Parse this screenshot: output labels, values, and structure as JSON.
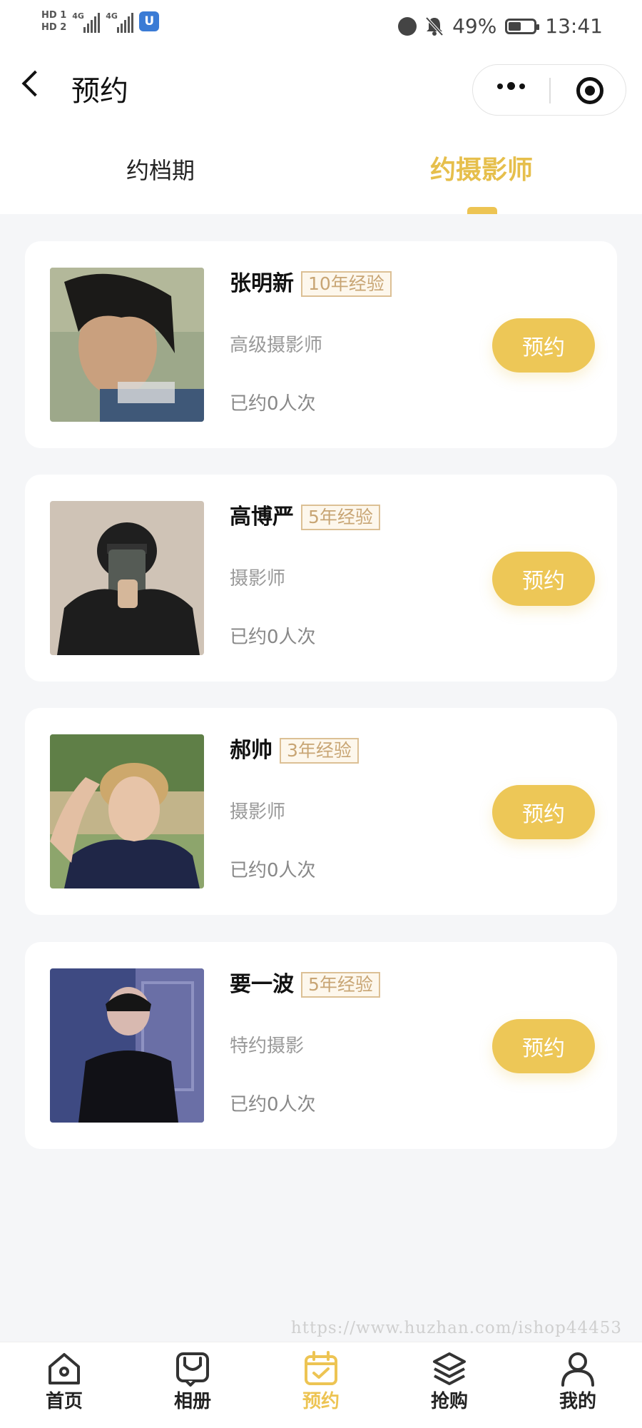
{
  "status_bar": {
    "hd1": "HD 1",
    "hd2": "HD 2",
    "net1": "4G",
    "net2": "4G",
    "app_badge": "U",
    "battery_text": "49%",
    "battery_level": 0.49,
    "time": "13:41"
  },
  "header": {
    "title": "预约"
  },
  "tabs": [
    {
      "label": "约档期",
      "active": false
    },
    {
      "label": "约摄影师",
      "active": true
    }
  ],
  "photographers": [
    {
      "name": "张明新",
      "experience": "10年经验",
      "role": "高级摄影师",
      "booked": "已约0人次",
      "button": "预约"
    },
    {
      "name": "高博严",
      "experience": "5年经验",
      "role": "摄影师",
      "booked": "已约0人次",
      "button": "预约"
    },
    {
      "name": "郝帅",
      "experience": "3年经验",
      "role": "摄影师",
      "booked": "已约0人次",
      "button": "预约"
    },
    {
      "name": "要一波",
      "experience": "5年经验",
      "role": "特约摄影",
      "booked": "已约0人次",
      "button": "预约"
    }
  ],
  "watermark": "https://www.huzhan.com/ishop44453",
  "tabbar": [
    {
      "label": "首页",
      "icon": "home-icon",
      "active": false
    },
    {
      "label": "相册",
      "icon": "album-icon",
      "active": false
    },
    {
      "label": "预约",
      "icon": "calendar-check-icon",
      "active": true
    },
    {
      "label": "抢购",
      "icon": "layers-icon",
      "active": false
    },
    {
      "label": "我的",
      "icon": "user-icon",
      "active": false
    }
  ],
  "colors": {
    "accent": "#edc453",
    "button": "#edc757",
    "exp_border": "#dcc095",
    "exp_text": "#c8a574",
    "background": "#f5f6f8"
  }
}
